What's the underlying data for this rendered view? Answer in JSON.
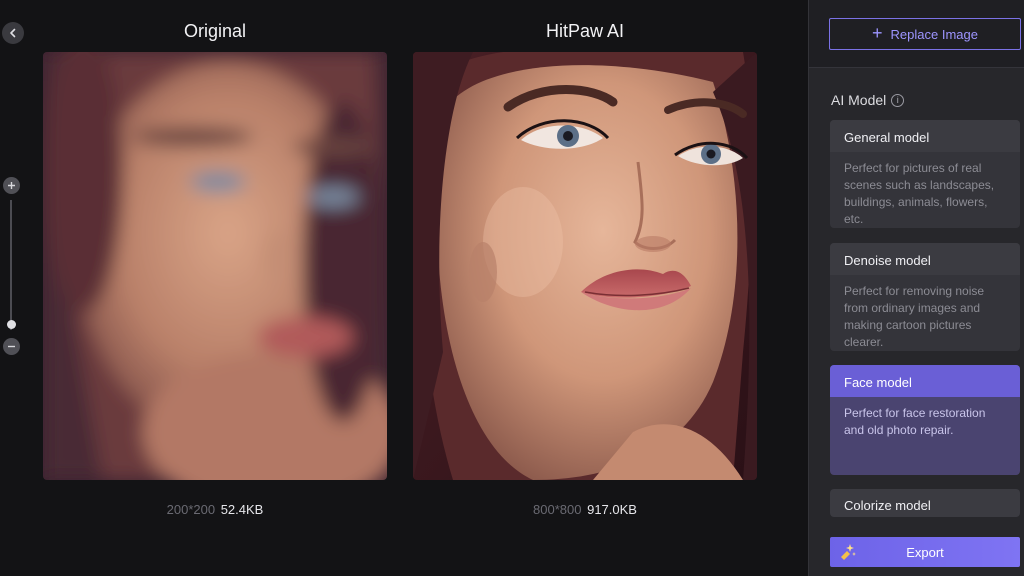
{
  "panes": {
    "original": {
      "title": "Original",
      "dimensions": "200*200",
      "size": "52.4KB"
    },
    "enhanced": {
      "title": "HitPaw AI",
      "dimensions": "800*800",
      "size": "917.0KB"
    }
  },
  "sidebar": {
    "replace_label": "Replace Image",
    "ai_model_label": "AI Model",
    "info_glyph": "i",
    "models": [
      {
        "name": "General model",
        "description": "Perfect for pictures of real scenes such as landscapes, buildings, animals, flowers, etc."
      },
      {
        "name": "Denoise model",
        "description": "Perfect for removing noise from ordinary images and making cartoon pictures clearer."
      },
      {
        "name": "Face model",
        "description": "Perfect for face restoration and old photo repair."
      },
      {
        "name": "Colorize model"
      }
    ],
    "selected_model": "Face model",
    "export_label": "Export"
  },
  "icons": {
    "back": "chevron-left-icon",
    "zoom_in": "plus-circle-icon",
    "zoom_out": "minus-circle-icon",
    "replace": "plus-icon",
    "info": "info-icon",
    "export": "export-sparkle-icon"
  },
  "colors": {
    "accent": "#7b72e6",
    "selected_card": "#6a5fd6",
    "background": "#131315",
    "sidebar": "#27272b"
  }
}
